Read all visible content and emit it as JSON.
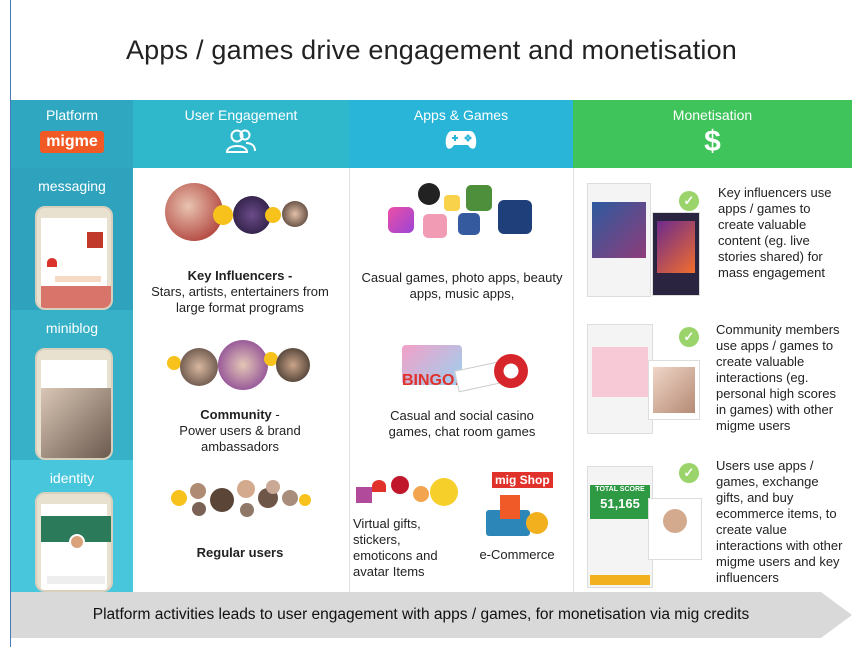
{
  "title": "Apps / games drive engagement and monetisation",
  "headers": {
    "platform": "Platform",
    "platform_logo": "migme",
    "engagement": "User Engagement",
    "apps": "Apps & Games",
    "monetisation": "Monetisation",
    "monetisation_symbol": "$"
  },
  "platform_items": [
    "messaging",
    "miniblog",
    "identity"
  ],
  "engagement": {
    "key_influencers_title": "Key Influencers -",
    "key_influencers_desc": "Stars, artists, entertainers from large format programs",
    "community_title": "Community",
    "community_suffix": " -",
    "community_desc": "Power users & brand ambassadors",
    "regular_users": "Regular users"
  },
  "apps": {
    "casual_games": "Casual games, photo apps, beauty apps, music apps,",
    "casino_games": "Casual and social casino games, chat room games",
    "virtual_gifts": "Virtual gifts, stickers, emoticons and avatar Items",
    "ecommerce": "e-Commerce",
    "migshop_label": "mig Shop",
    "bingo_label": "BINGO!"
  },
  "monetisation": {
    "row1": "Key influencers use apps / games to create valuable content (eg. live stories shared) for mass engagement",
    "row2": "Community members use apps / games to create valuable interactions (eg. personal high scores in games) with other migme users",
    "row3": "Users use apps / games, exchange gifts, and buy ecommerce items, to create value interactions with other migme users and key influencers",
    "score_label": "TOTAL SCORE",
    "score_value": "51,165"
  },
  "footer": "Platform activities leads to user engagement with apps / games, for monetisation via mig credits",
  "colors": {
    "platform": "#2fa7c0",
    "engagement": "#2fb8cc",
    "apps": "#29b5d8",
    "monetisation": "#3ec45a",
    "migme": "#f15a24"
  }
}
